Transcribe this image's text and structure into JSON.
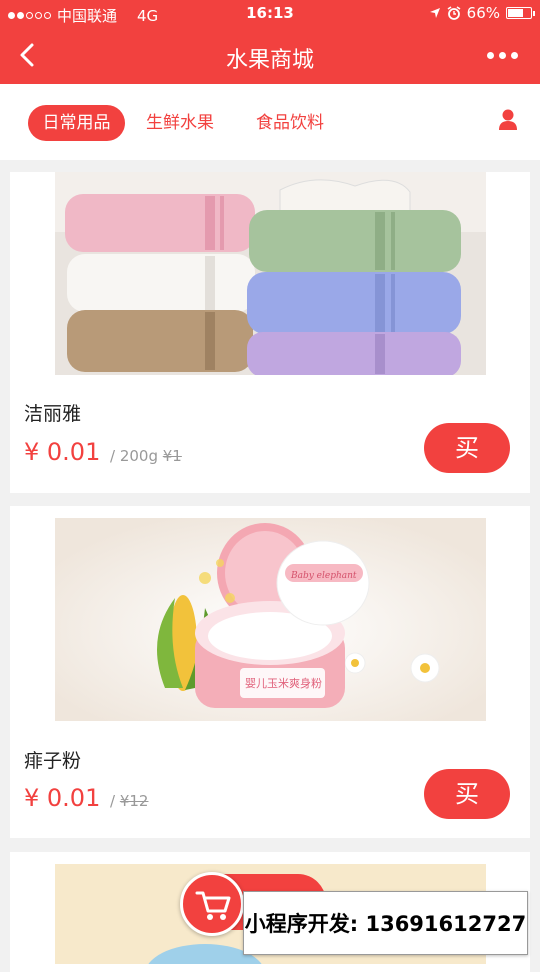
{
  "status_bar": {
    "carrier": "中国联通",
    "network": "4G",
    "time": "16:13",
    "battery": "66%",
    "battery_level": 0.66
  },
  "nav": {
    "title": "水果商城"
  },
  "tabs": [
    {
      "label": "日常用品",
      "active": true
    },
    {
      "label": "生鲜水果",
      "active": false
    },
    {
      "label": "食品饮料",
      "active": false
    }
  ],
  "products": [
    {
      "name": "洁丽雅",
      "price": "¥ 0.01",
      "unit": "/ 200g",
      "old_price": "¥1",
      "buy_label": "买"
    },
    {
      "name": "痱子粉",
      "price": "¥ 0.01",
      "unit": "/",
      "old_price": "¥12",
      "buy_label": "买"
    }
  ],
  "product_image_text": {
    "powder_lid": "Baby elephant",
    "powder_label": "婴儿玉米爽身粉"
  },
  "promo_text": "小程序开发: 13691612727",
  "colors": {
    "brand_red": "#f2413f",
    "background": "#f1f1f1"
  }
}
